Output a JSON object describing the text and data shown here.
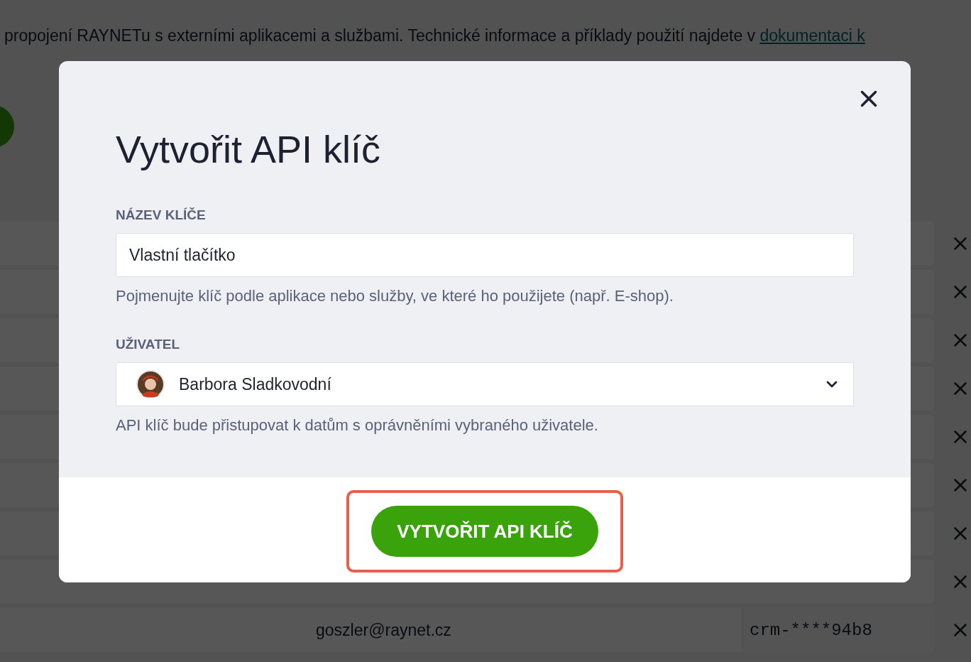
{
  "page": {
    "intro": {
      "text": "propojení RAYNETu s externími aplikacemi a službami. Technické informace a příklady použití najdete v ",
      "link": "dokumentaci k"
    },
    "rows": [
      {
        "kind": "covered"
      },
      {
        "kind": "covered"
      },
      {
        "kind": "covered"
      },
      {
        "kind": "covered"
      },
      {
        "kind": "covered"
      },
      {
        "kind": "covered"
      },
      {
        "kind": "covered"
      },
      {
        "kind": "covered"
      },
      {
        "kind": "visible",
        "email": "goszler@raynet.cz",
        "key": "crm-****94b8"
      }
    ]
  },
  "dialog": {
    "title": "Vytvořit API klíč",
    "fields": [
      {
        "kind": "text",
        "label": "NÁZEV KLÍČE",
        "value": "Vlastní tlačítko",
        "hint": "Pojmenujte klíč podle aplikace nebo služby, ve které ho použijete (např. E-shop)."
      },
      {
        "kind": "user-select",
        "label": "UŽIVATEL",
        "value": "Barbora Sladkovodní",
        "hint": "API klíč bude přistupovat k datům s oprávněními vybraného uživatele."
      }
    ],
    "submit": {
      "label": "VYTVOŘIT API KLÍČ",
      "highlighted": true
    }
  }
}
